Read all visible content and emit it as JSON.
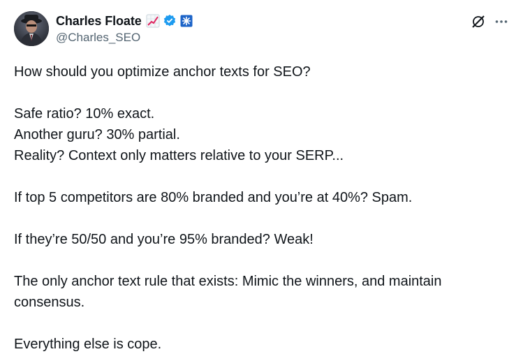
{
  "author": {
    "display_name": "Charles Floate",
    "handle": "@Charles_SEO",
    "avatar_icon": "avatar-portrait",
    "badges": [
      "chart-increasing-emoji",
      "verified-badge-icon",
      "affiliate-badge-icon"
    ]
  },
  "colors": {
    "text": "#0f1419",
    "secondary": "#536471",
    "verified_blue": "#1d9bf0",
    "affiliate_blue": "#1d64c8"
  },
  "tweet": {
    "lines": [
      "How should you optimize anchor texts for SEO?",
      "",
      "Safe ratio? 10% exact.",
      "Another guru? 30% partial.",
      "Reality? Context only matters relative to your SERP...",
      "",
      "If top 5 competitors are 80% branded and you’re at 40%? Spam.",
      "",
      "If they’re 50/50 and you’re 95% branded? Weak!",
      "",
      "The only anchor text rule that exists: Mimic the winners, and maintain consensus.",
      "",
      "Everything else is cope."
    ]
  },
  "actions": {
    "grok_icon": "grok-icon",
    "more_icon": "more-options-icon"
  }
}
